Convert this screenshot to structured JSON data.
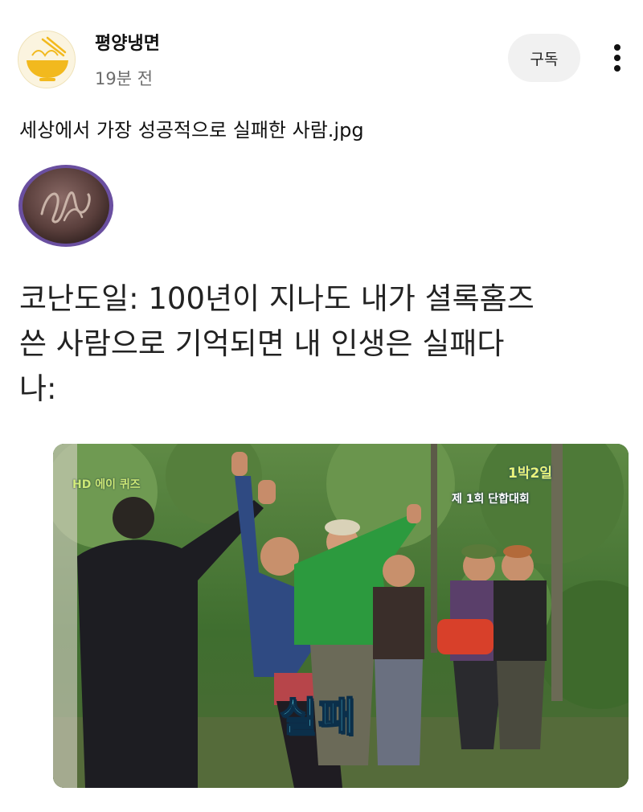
{
  "post": {
    "author": "평양냉면",
    "time": "19분 전",
    "subscribe_label": "구독",
    "title": "세상에서 가장 성공적으로 실패한 사람.jpg",
    "quote_lines": [
      "코난도일: 100년이 지나도 내가 셜록홈즈",
      "쓴 사람으로 기억되면 내 인생은 실패다",
      "나:"
    ]
  },
  "icons": {
    "avatar": "noodle-bowl-icon",
    "more": "vertical-ellipsis-icon",
    "seal": "monogram-seal"
  },
  "photo": {
    "caption_left": "HD 에이 퀴즈",
    "caption_right_top": "1박2일",
    "caption_right_bottom": "제 1회 단합대회",
    "caption_fail": "실패"
  },
  "colors": {
    "accent_yellow": "#f2b91e",
    "button_bg": "#f1f1f1",
    "muted_text": "#6d6d6d",
    "fail_caption": "#5fe0f5"
  }
}
